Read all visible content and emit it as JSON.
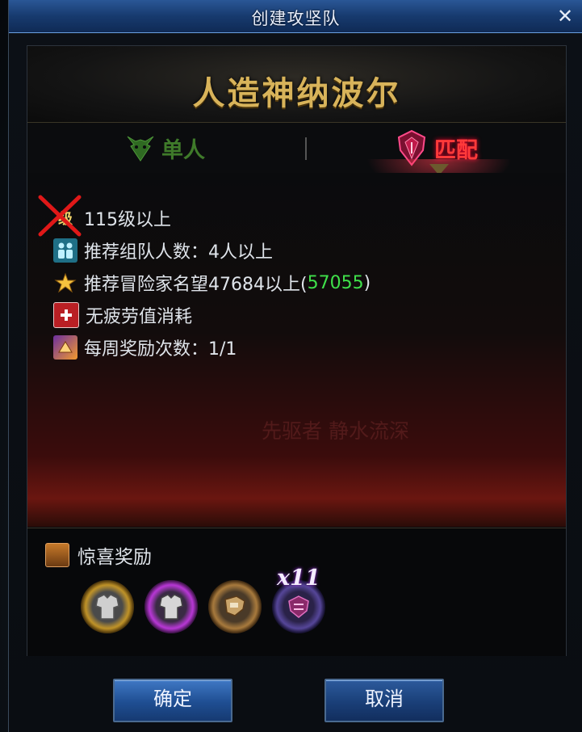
{
  "window": {
    "title": "创建攻坚队",
    "close_label": "✕"
  },
  "raid": {
    "name": "人造神纳波尔"
  },
  "tabs": [
    {
      "label": "单人",
      "selected": false
    },
    {
      "label": "匹配",
      "selected": true
    }
  ],
  "requirements": {
    "level": "115级以上",
    "level_icon_text": "级",
    "party_size": "推荐组队人数：4人以上",
    "fame_prefix": "推荐冒险家名望47684以上(",
    "fame_current": "57055",
    "fame_suffix": ")",
    "fatigue": "无疲劳值消耗",
    "weekly": "每周奖励次数：1/1"
  },
  "background_text": "先驱者 静水流深",
  "rewards": {
    "title": "惊喜奖励",
    "items": [
      {
        "icon": "armor-icon",
        "ring": "gold"
      },
      {
        "icon": "armor-icon",
        "ring": "purple"
      },
      {
        "icon": "gauntlet-icon",
        "ring": "bronze"
      },
      {
        "icon": "emblem-icon",
        "ring": "dark",
        "count": "x11"
      }
    ]
  },
  "buttons": {
    "confirm": "确定",
    "cancel": "取消"
  },
  "colors": {
    "fame_current": "#3fe04a",
    "selected_tab": "#ff3a3a",
    "raid_name": "#d8b35a"
  }
}
